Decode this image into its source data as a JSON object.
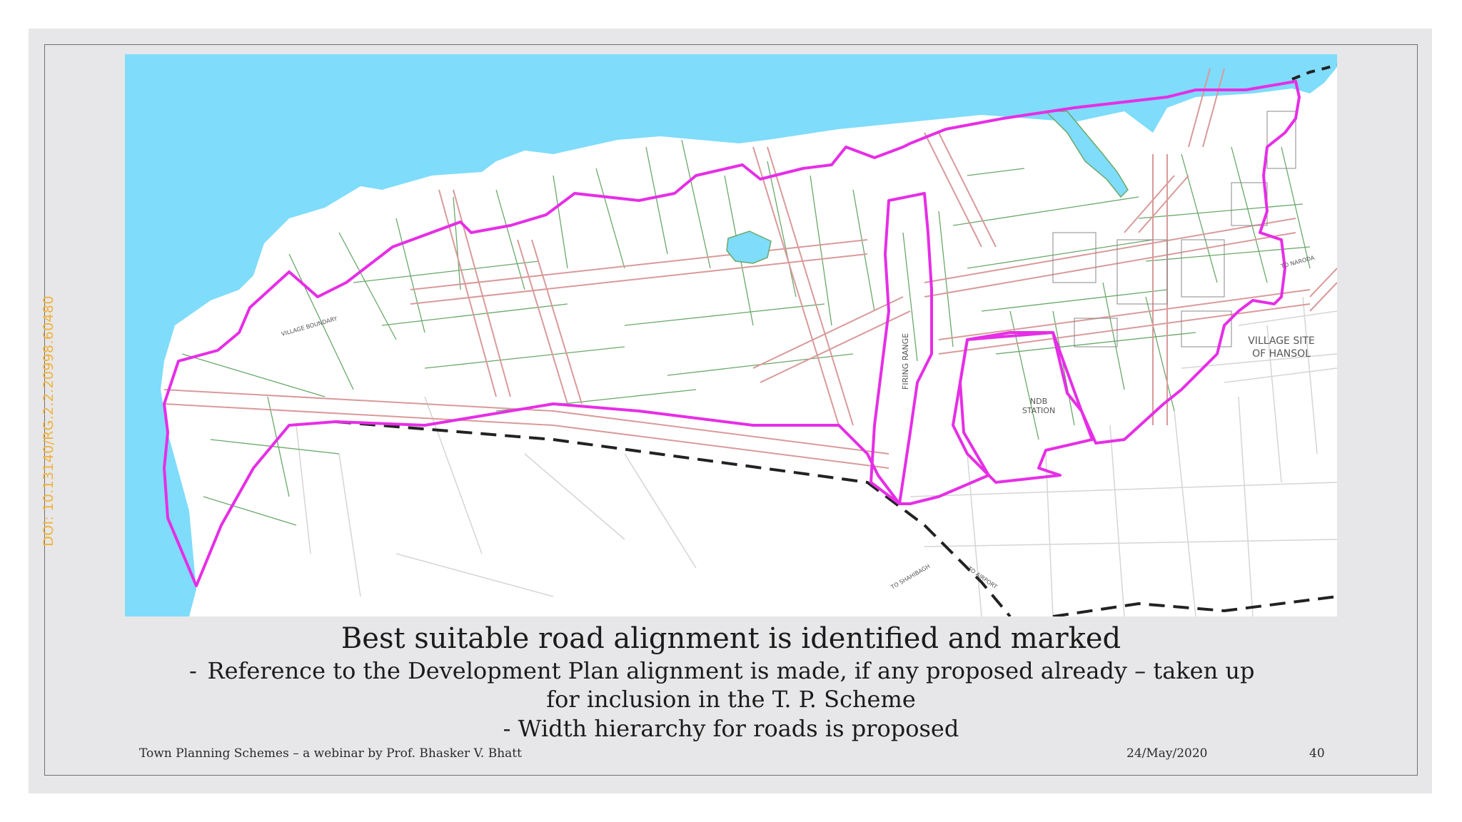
{
  "slide": {
    "doi": "DOI: 10.13140/RG.2.2.20998.60480",
    "heading": "Best suitable road alignment is identified and marked",
    "bullets": [
      {
        "dash": "-",
        "text": "Reference to the Development Plan alignment is made, if any proposed already – taken up"
      },
      {
        "text": "for inclusion in the T. P. Scheme"
      },
      {
        "text": "-  Width hierarchy for roads is proposed"
      }
    ],
    "footer": {
      "left": "Town Planning Schemes – a webinar by Prof. Bhasker V. Bhatt",
      "date": "24/May/2020",
      "page": "40"
    }
  },
  "map": {
    "labels": {
      "village_site_line1": "VILLAGE SITE",
      "village_site_line2": "OF HANSOL",
      "ndb_line1": "NDB",
      "ndb_line2": "STATION",
      "firing_range": "FIRING RANGE",
      "village_boundary": "VILLAGE BOUNDARY",
      "to_naroda": "TO NARODA",
      "to_shahibagh": "TO SHAHIBAGH",
      "to_airport": "TO AIRPORT"
    },
    "colors": {
      "water": "#7fdcfa",
      "scheme_boundary": "#e62ee6",
      "roads": "#d99a9a",
      "plots": "#6aa86a",
      "land": "#ffffff"
    }
  }
}
